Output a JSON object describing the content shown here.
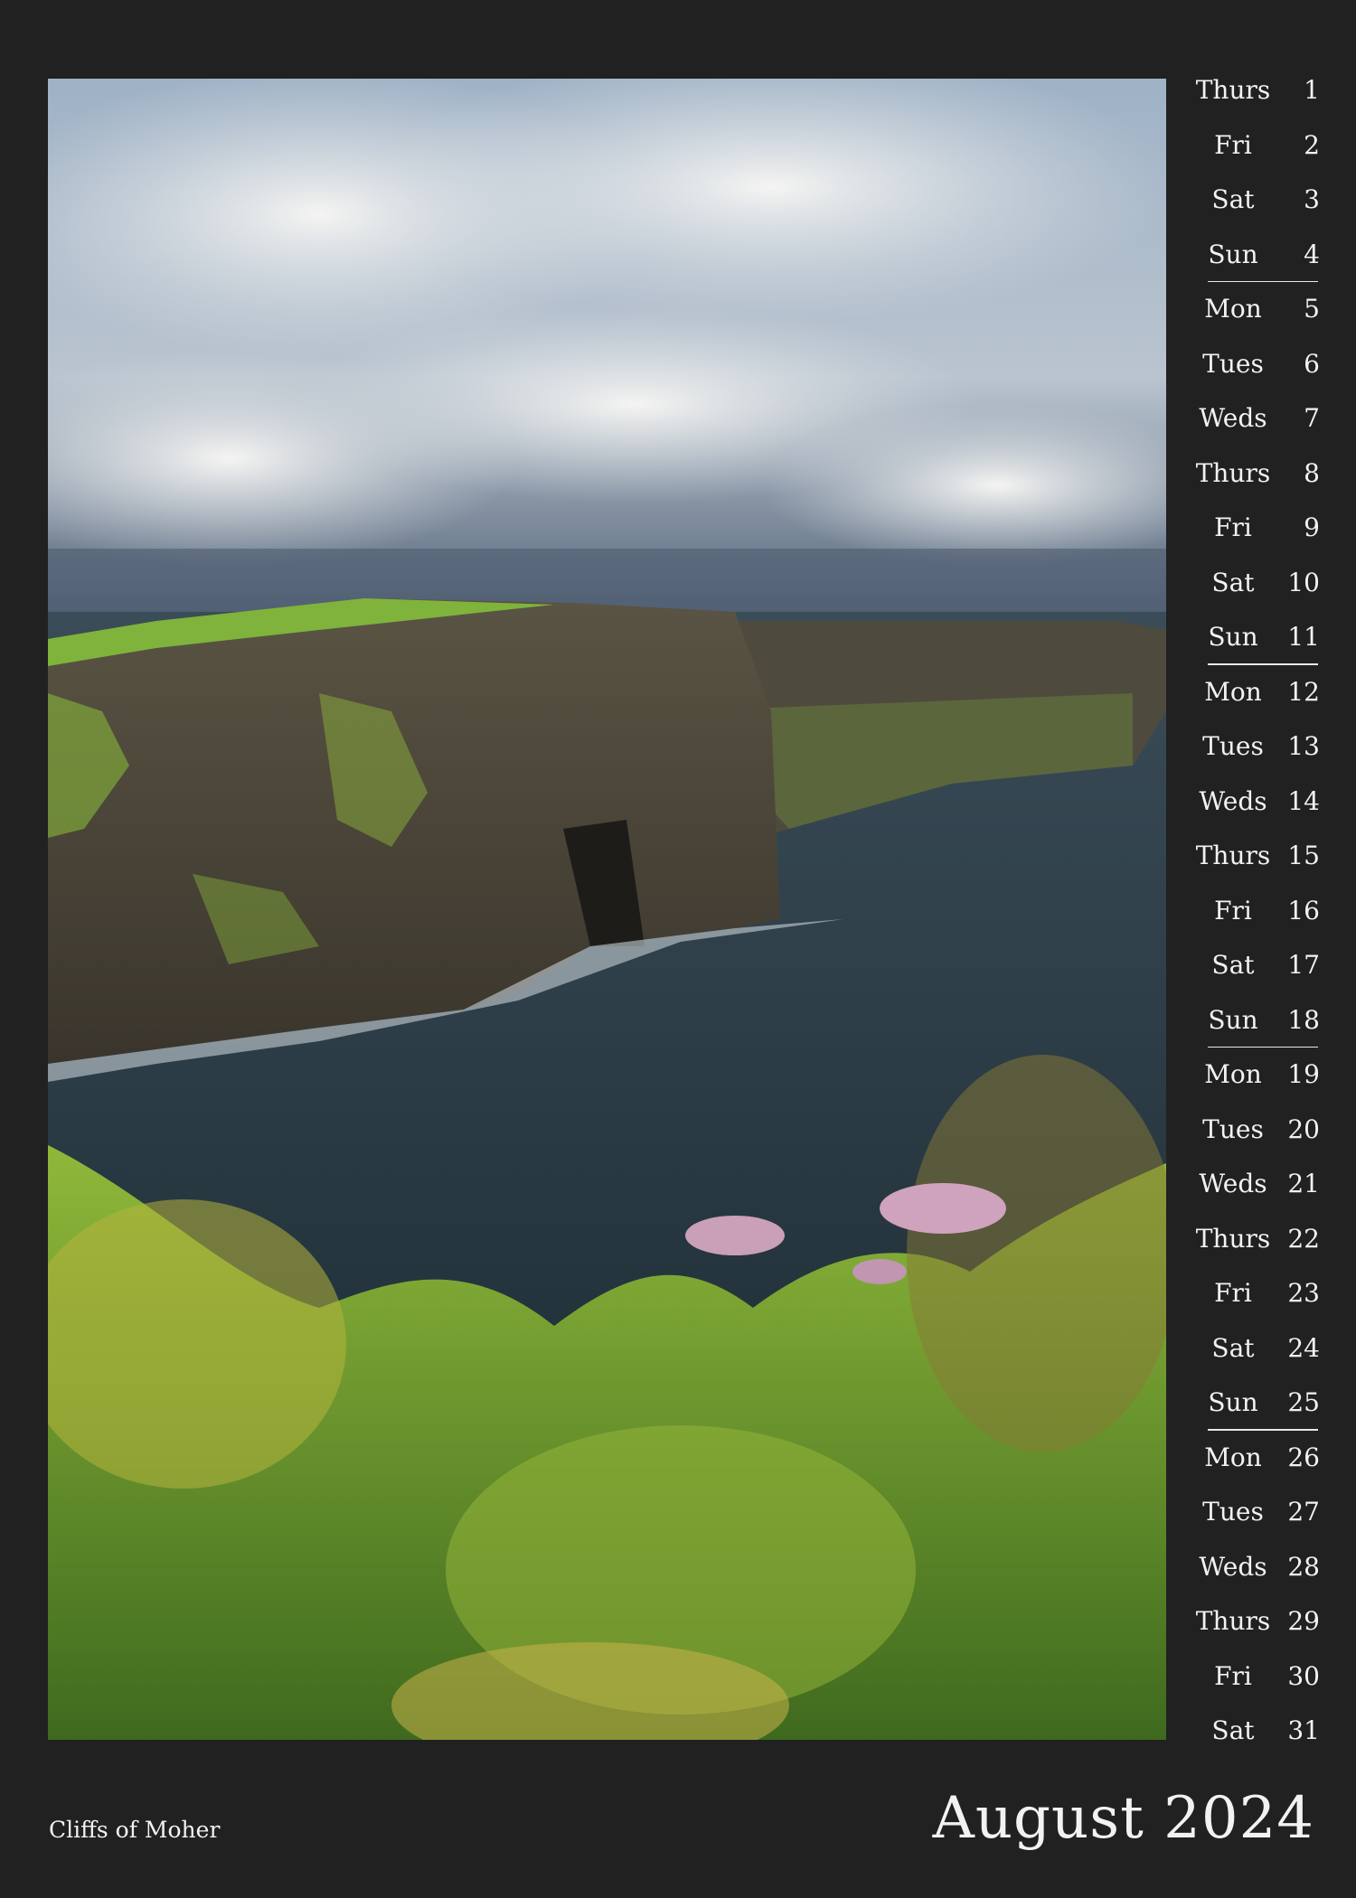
{
  "photo": {
    "subject": "sea cliffs with flowers in foreground",
    "colors": {
      "sky_top": "#8fa6be",
      "cloud": "#e6e8ea",
      "sea": "#2a3a44",
      "cliff": "#4a4436",
      "grass": "#7aa33a",
      "flower": "#c9a0b8"
    }
  },
  "calendar": {
    "days": [
      {
        "name": "Thurs",
        "num": "1",
        "week_end": false
      },
      {
        "name": "Fri",
        "num": "2",
        "week_end": false
      },
      {
        "name": "Sat",
        "num": "3",
        "week_end": false
      },
      {
        "name": "Sun",
        "num": "4",
        "week_end": true
      },
      {
        "name": "Mon",
        "num": "5",
        "week_end": false
      },
      {
        "name": "Tues",
        "num": "6",
        "week_end": false
      },
      {
        "name": "Weds",
        "num": "7",
        "week_end": false
      },
      {
        "name": "Thurs",
        "num": "8",
        "week_end": false
      },
      {
        "name": "Fri",
        "num": "9",
        "week_end": false
      },
      {
        "name": "Sat",
        "num": "10",
        "week_end": false
      },
      {
        "name": "Sun",
        "num": "11",
        "week_end": true
      },
      {
        "name": "Mon",
        "num": "12",
        "week_end": false
      },
      {
        "name": "Tues",
        "num": "13",
        "week_end": false
      },
      {
        "name": "Weds",
        "num": "14",
        "week_end": false
      },
      {
        "name": "Thurs",
        "num": "15",
        "week_end": false
      },
      {
        "name": "Fri",
        "num": "16",
        "week_end": false
      },
      {
        "name": "Sat",
        "num": "17",
        "week_end": false
      },
      {
        "name": "Sun",
        "num": "18",
        "week_end": true
      },
      {
        "name": "Mon",
        "num": "19",
        "week_end": false
      },
      {
        "name": "Tues",
        "num": "20",
        "week_end": false
      },
      {
        "name": "Weds",
        "num": "21",
        "week_end": false
      },
      {
        "name": "Thurs",
        "num": "22",
        "week_end": false
      },
      {
        "name": "Fri",
        "num": "23",
        "week_end": false
      },
      {
        "name": "Sat",
        "num": "24",
        "week_end": false
      },
      {
        "name": "Sun",
        "num": "25",
        "week_end": true
      },
      {
        "name": "Mon",
        "num": "26",
        "week_end": false
      },
      {
        "name": "Tues",
        "num": "27",
        "week_end": false
      },
      {
        "name": "Weds",
        "num": "28",
        "week_end": false
      },
      {
        "name": "Thurs",
        "num": "29",
        "week_end": false
      },
      {
        "name": "Fri",
        "num": "30",
        "week_end": false
      },
      {
        "name": "Sat",
        "num": "31",
        "week_end": false
      }
    ]
  },
  "caption": "Cliffs of Moher",
  "month_title": "August 2024",
  "colors": {
    "background": "#212121",
    "text": "#f2f2f2",
    "rule": "#e8e8e8"
  }
}
